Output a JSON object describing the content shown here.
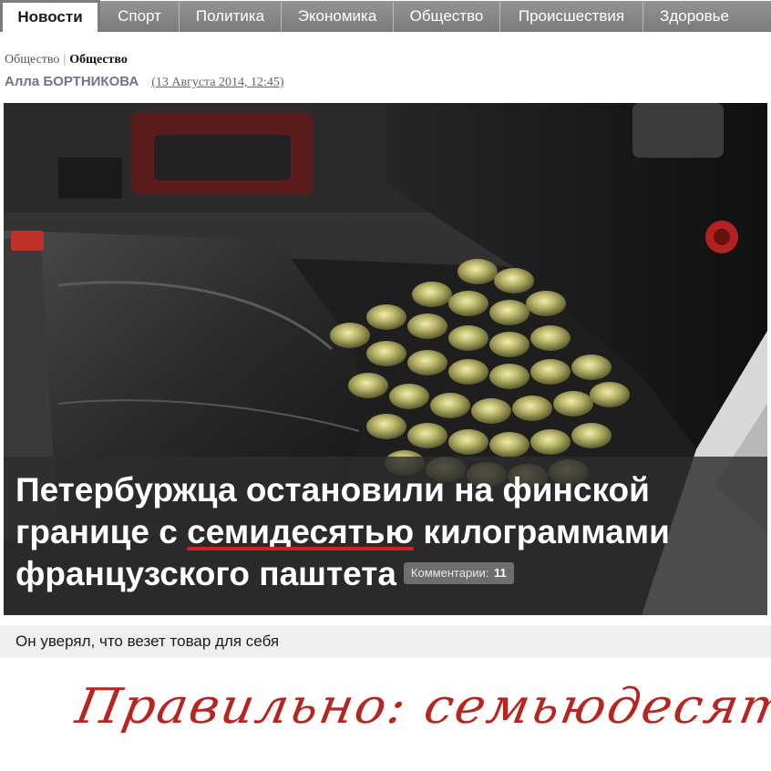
{
  "nav": {
    "tabs": [
      {
        "label": "Новости",
        "active": true
      },
      {
        "label": "Спорт",
        "active": false
      },
      {
        "label": "Политика",
        "active": false
      },
      {
        "label": "Экономика",
        "active": false
      },
      {
        "label": "Общество",
        "active": false
      },
      {
        "label": "Происшествия",
        "active": false
      },
      {
        "label": "Здоровье",
        "active": false
      }
    ]
  },
  "breadcrumb": {
    "parent": "Общество",
    "separator": "|",
    "current": "Общество"
  },
  "byline": {
    "author": "Алла БОРТНИКОВА",
    "date": "(13 Августа 2014, 12:45)"
  },
  "article": {
    "headline_part1": "Петербуржца остановили на финской границе с ",
    "headline_error_word": "семидесятью",
    "headline_part2": " килограммами французского паштета",
    "comments_label": "Комментарии:",
    "comments_count": "11",
    "lead": "Он уверял, что везет товар для себя"
  },
  "correction_text": "Правильно: семьюдесятью!",
  "icons": {
    "photo": "car-interior-cans-photo"
  },
  "colors": {
    "nav_bg": "#888888",
    "error_underline": "#d81f1f",
    "correction": "#b82520",
    "author": "#7a6f8a"
  }
}
